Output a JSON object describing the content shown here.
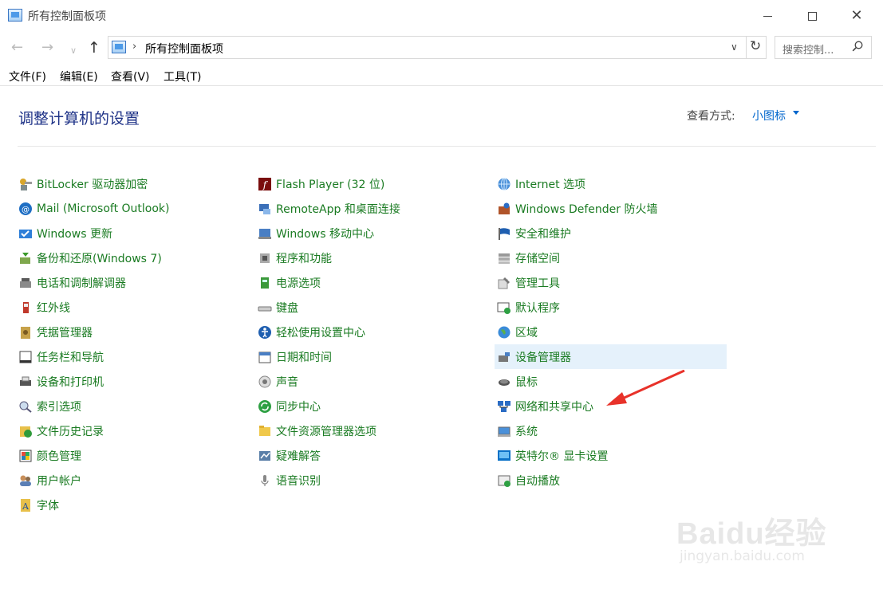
{
  "window": {
    "title": "所有控制面板项"
  },
  "nav": {
    "path": "所有控制面板项",
    "search_placeholder": "搜索控制..."
  },
  "menu": [
    "文件(F)",
    "编辑(E)",
    "查看(V)",
    "工具(T)"
  ],
  "header": {
    "title": "调整计算机的设置",
    "view_by_label": "查看方式:",
    "view_by_value": "小图标"
  },
  "columns": [
    [
      {
        "label": "BitLocker 驱动器加密",
        "icon": "bitlocker-icon"
      },
      {
        "label": "Mail (Microsoft Outlook)",
        "icon": "mail-icon"
      },
      {
        "label": "Windows 更新",
        "icon": "windows-update-icon"
      },
      {
        "label": "备份和还原(Windows 7)",
        "icon": "backup-icon"
      },
      {
        "label": "电话和调制解调器",
        "icon": "phone-modem-icon"
      },
      {
        "label": "红外线",
        "icon": "infrared-icon"
      },
      {
        "label": "凭据管理器",
        "icon": "credential-icon"
      },
      {
        "label": "任务栏和导航",
        "icon": "taskbar-icon"
      },
      {
        "label": "设备和打印机",
        "icon": "printer-icon"
      },
      {
        "label": "索引选项",
        "icon": "indexing-icon"
      },
      {
        "label": "文件历史记录",
        "icon": "file-history-icon"
      },
      {
        "label": "颜色管理",
        "icon": "color-management-icon"
      },
      {
        "label": "用户帐户",
        "icon": "user-accounts-icon"
      },
      {
        "label": "字体",
        "icon": "fonts-icon"
      }
    ],
    [
      {
        "label": "Flash Player (32 位)",
        "icon": "flash-player-icon"
      },
      {
        "label": "RemoteApp 和桌面连接",
        "icon": "remoteapp-icon"
      },
      {
        "label": "Windows 移动中心",
        "icon": "mobility-center-icon"
      },
      {
        "label": "程序和功能",
        "icon": "programs-icon"
      },
      {
        "label": "电源选项",
        "icon": "power-icon"
      },
      {
        "label": "键盘",
        "icon": "keyboard-icon"
      },
      {
        "label": "轻松使用设置中心",
        "icon": "ease-of-access-icon"
      },
      {
        "label": "日期和时间",
        "icon": "date-time-icon"
      },
      {
        "label": "声音",
        "icon": "sound-icon"
      },
      {
        "label": "同步中心",
        "icon": "sync-center-icon"
      },
      {
        "label": "文件资源管理器选项",
        "icon": "folder-options-icon"
      },
      {
        "label": "疑难解答",
        "icon": "troubleshooting-icon"
      },
      {
        "label": "语音识别",
        "icon": "microphone-icon"
      }
    ],
    [
      {
        "label": "Internet 选项",
        "icon": "internet-options-icon"
      },
      {
        "label": "Windows Defender 防火墙",
        "icon": "firewall-icon"
      },
      {
        "label": "安全和维护",
        "icon": "flag-icon"
      },
      {
        "label": "存储空间",
        "icon": "storage-icon"
      },
      {
        "label": "管理工具",
        "icon": "admin-tools-icon"
      },
      {
        "label": "默认程序",
        "icon": "default-programs-icon"
      },
      {
        "label": "区域",
        "icon": "region-icon"
      },
      {
        "label": "设备管理器",
        "icon": "device-manager-icon",
        "highlighted": true
      },
      {
        "label": "鼠标",
        "icon": "mouse-icon"
      },
      {
        "label": "网络和共享中心",
        "icon": "network-icon"
      },
      {
        "label": "系统",
        "icon": "system-icon"
      },
      {
        "label": "英特尔® 显卡设置",
        "icon": "intel-graphics-icon"
      },
      {
        "label": "自动播放",
        "icon": "autoplay-icon"
      }
    ]
  ],
  "colors": {
    "link": "#1a7b22",
    "title": "#1e3287",
    "accent": "#0066cc",
    "highlight": "#e5f1fb",
    "annotation_arrow": "#e8322a"
  },
  "watermark": {
    "brand": "Baidu经验",
    "url": "jingyan.baidu.com"
  }
}
